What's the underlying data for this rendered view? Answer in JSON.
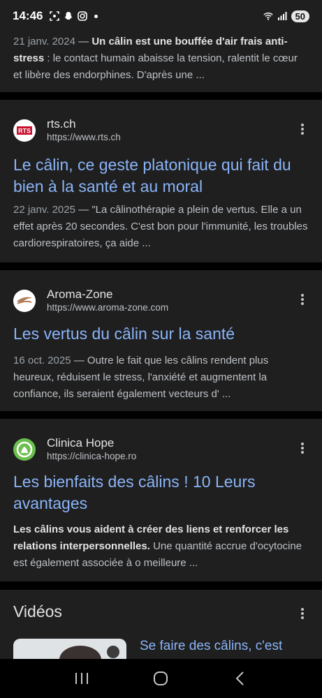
{
  "status_bar": {
    "time": "14:46",
    "battery": "50"
  },
  "results": [
    {
      "date": "21 janv. 2024",
      "bold": "Un câlin est une bouffée d'air frais anti-stress",
      "rest": " : le contact humain abaisse la tension, ralentit le cœur et libère des endorphines. D'après une ..."
    },
    {
      "source": "rts.ch",
      "url": "https://www.rts.ch",
      "favicon_label": "RTS",
      "title": "Le câlin, ce geste platonique qui fait du bien à la santé et au moral",
      "date": "22 janv. 2025",
      "snippet": "\"La câlinothérapie a plein de vertus. Elle a un effet après 20 secondes. C'est bon pour l'immunité, les troubles cardiorespiratoires, ça aide ..."
    },
    {
      "source": "Aroma-Zone",
      "url": "https://www.aroma-zone.com",
      "title": "Les vertus du câlin sur la santé",
      "date": "16 oct. 2025",
      "snippet": "Outre le fait que les câlins rendent plus heureux, réduisent le stress, l'anxiété et augmentent la confiance, ils seraient également vecteurs d' ..."
    },
    {
      "source": "Clinica Hope",
      "url": "https://clinica-hope.ro",
      "title": "Les bienfaits des câlins ! 10 Leurs avantages",
      "bold": "Les câlins vous aident à créer des liens et renforcer les relations interpersonnelles.",
      "rest": " Une quantité accrue d'ocytocine est également associée à o meilleure ..."
    }
  ],
  "videos": {
    "heading": "Vidéos",
    "first_title": "Se faire des câlins, c'est"
  },
  "dash": " — "
}
